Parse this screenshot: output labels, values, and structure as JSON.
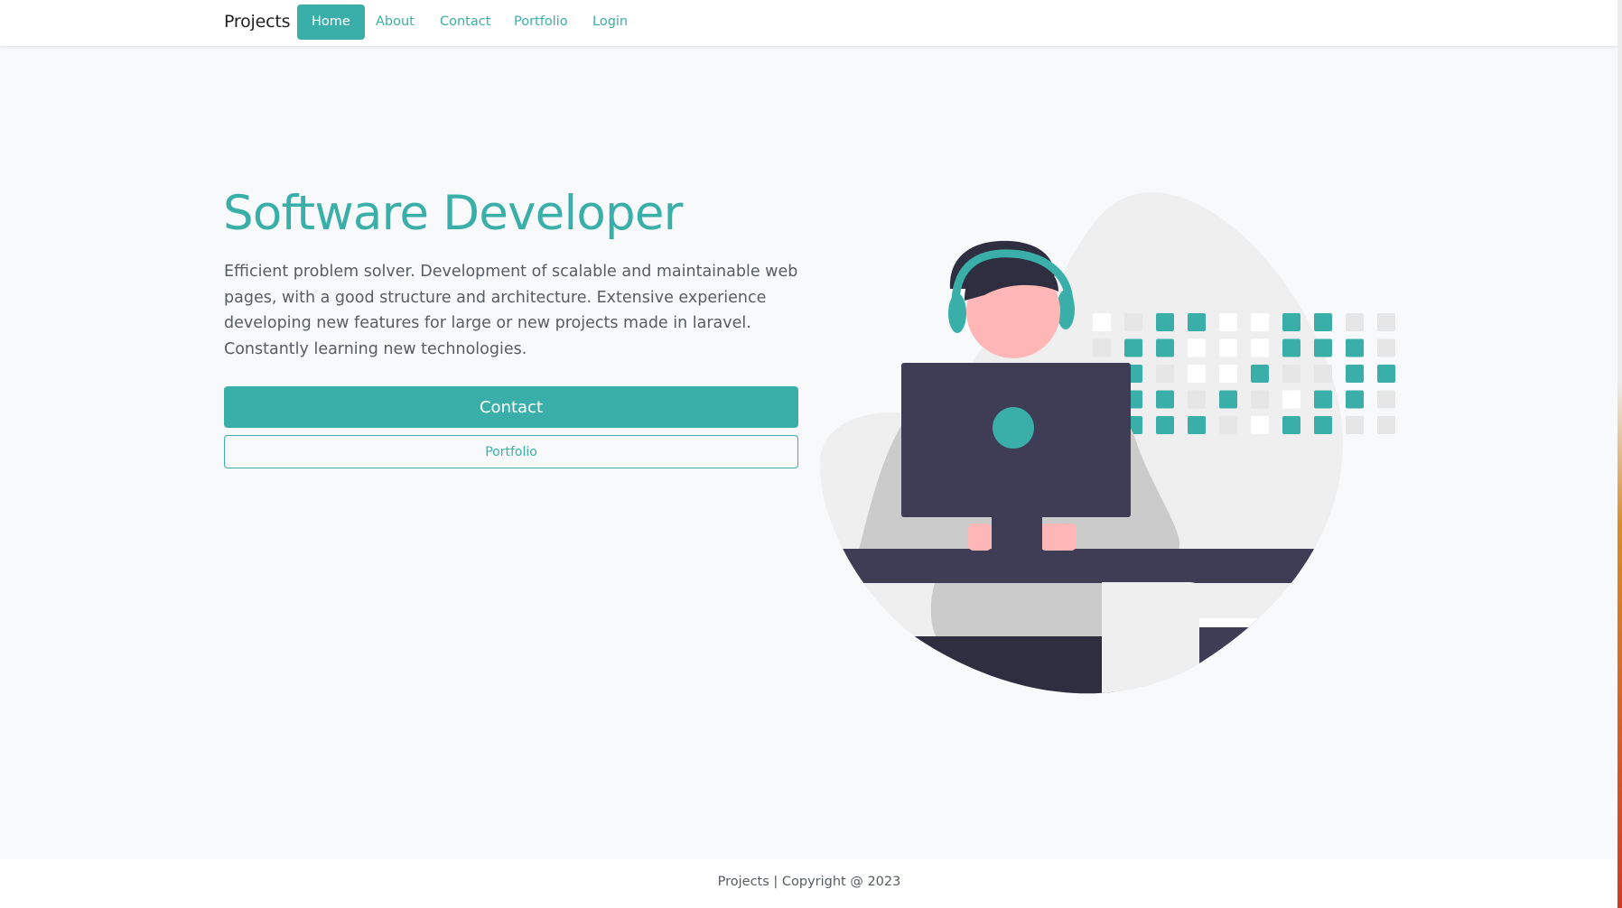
{
  "nav": {
    "brand": "Projects",
    "items": [
      {
        "label": "Home",
        "active": true
      },
      {
        "label": "About",
        "active": false
      },
      {
        "label": "Contact",
        "active": false
      },
      {
        "label": "Portfolio",
        "active": false
      },
      {
        "label": "Login",
        "active": false
      }
    ]
  },
  "hero": {
    "title": "Software Developer",
    "description": "Efficient problem solver. Development of scalable and maintainable web pages, with a good structure and architecture. Extensive experience developing new features for large or new projects made in laravel. Constantly learning new technologies.",
    "contact_button": "Contact",
    "portfolio_button": "Portfolio"
  },
  "illustration": {
    "icon": "developer-illustration",
    "colors": {
      "accent": "#3aafa9",
      "dark": "#3f3d56",
      "skin": "#ffb6b6",
      "shirt": "#cbcbcb",
      "blob": "#efefef"
    }
  },
  "footer": {
    "text": "Projects | Copyright @ 2023"
  },
  "colors": {
    "primary": "#3aafa9",
    "background": "#f8f9fa",
    "text": "#555b61"
  }
}
